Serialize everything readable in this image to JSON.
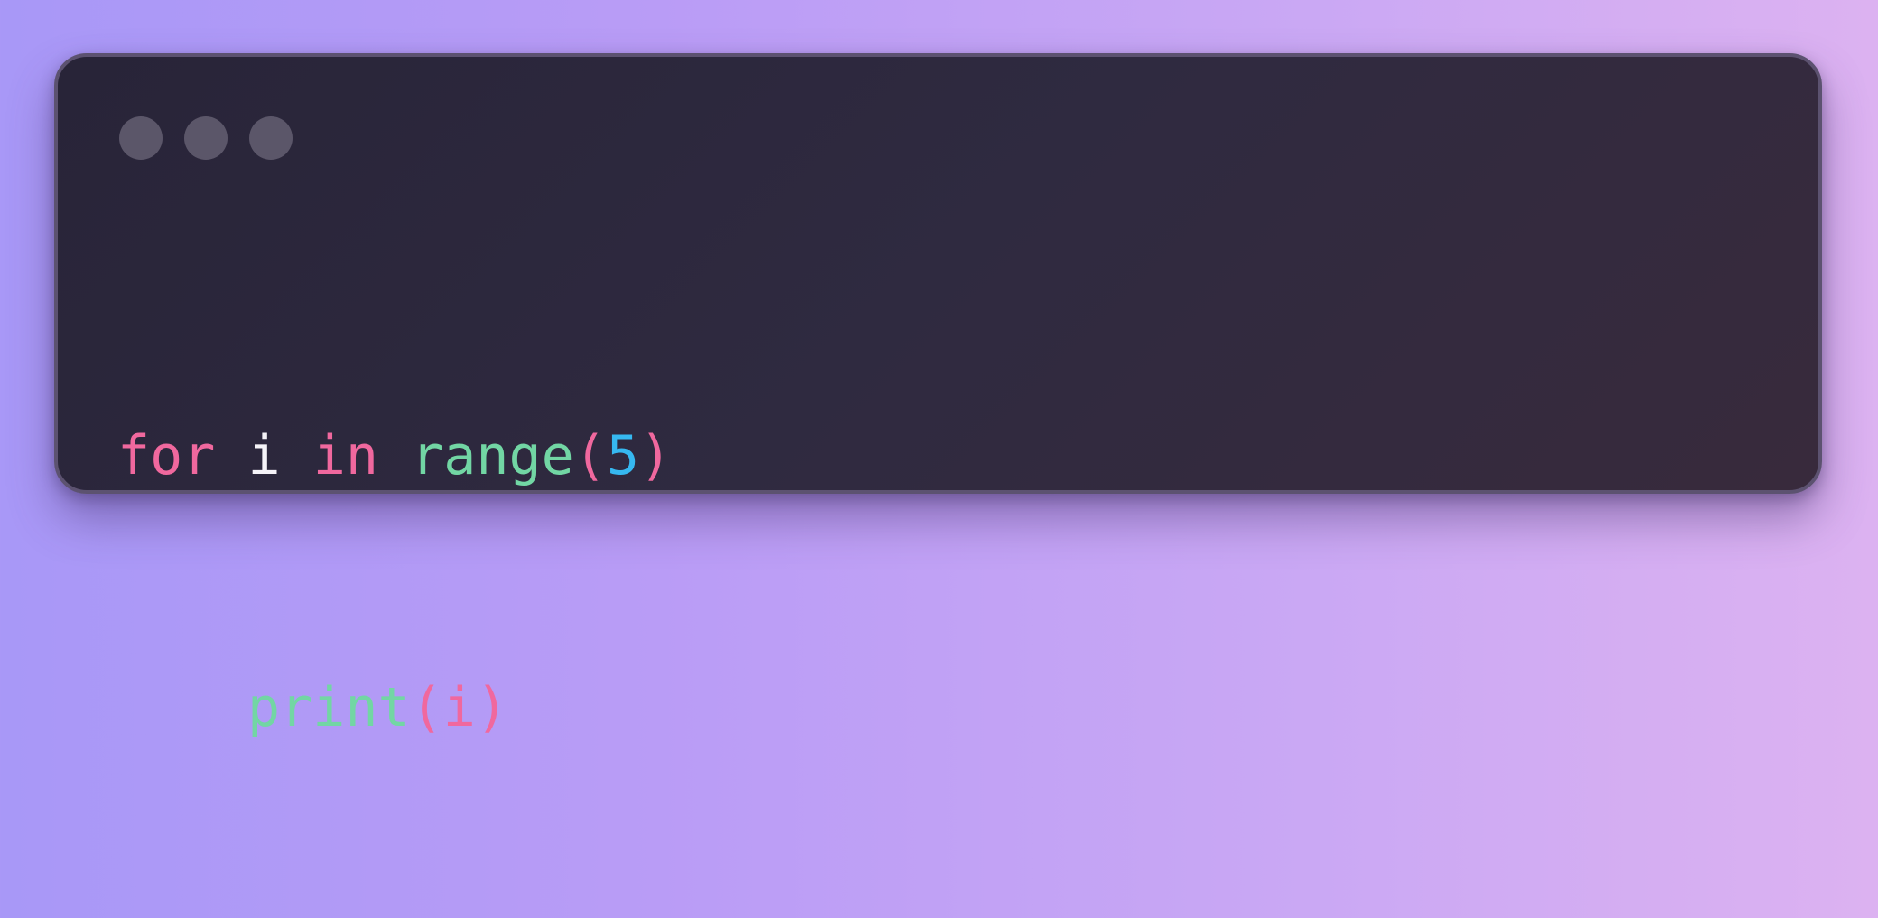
{
  "colors": {
    "keyword": "#f0689e",
    "variable": "#f5f3f8",
    "function": "#72d6a4",
    "paren": "#f0689e",
    "number": "#36b8f0",
    "window_background": "#2f2a40",
    "window_control": "#5b5669"
  },
  "window_controls": [
    "window-dot",
    "window-dot",
    "window-dot"
  ],
  "code": {
    "line1": {
      "kw_for": "for",
      "var_i": "i",
      "kw_in": "in",
      "fn_range": "range",
      "open_paren": "(",
      "number": "5",
      "close_paren": ")"
    },
    "line2": {
      "fn_print": "print",
      "open_paren": "(",
      "arg": "i",
      "close_paren": ")"
    }
  }
}
